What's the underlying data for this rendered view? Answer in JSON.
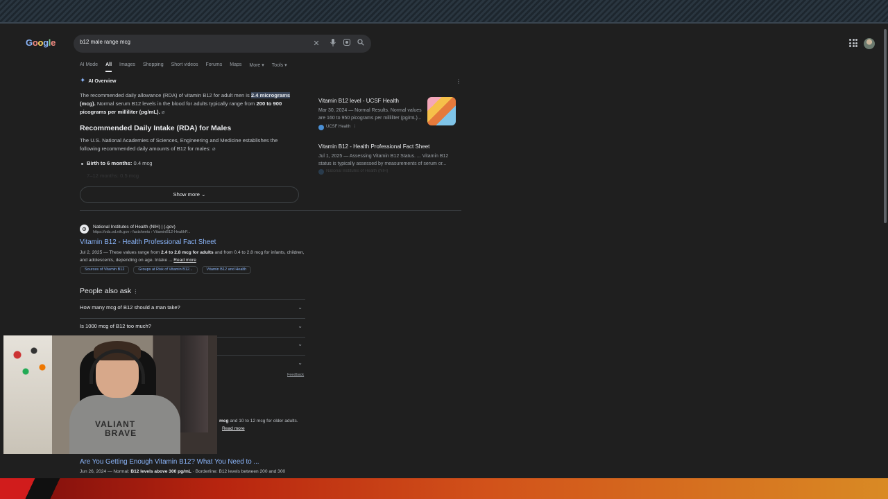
{
  "header": {
    "logo_text": "Google",
    "search_value": "b12 male range mcg",
    "clear_icon": "close-icon",
    "voice_icon": "mic-icon",
    "lens_icon": "lens-icon",
    "search_icon": "search-icon"
  },
  "tabs": [
    "AI Mode",
    "All",
    "Images",
    "Shopping",
    "Short videos",
    "Forums",
    "Maps",
    "More ▾",
    "Tools ▾"
  ],
  "ai_overview": {
    "title": "AI Overview",
    "p1_a": "The recommended daily allowance (RDA) of vitamin B12 for adult men is ",
    "p1_hl": "2.4 micrograms",
    "p1_b": " (mcg).",
    "p1_c": " Normal serum B12 levels in the blood for adults typically range from ",
    "p1_d": "200 to 900 picograms per milliliter (pg/mL).",
    "heading": "Recommended Daily Intake (RDA) for Males",
    "p2": "The U.S. National Academies of Sciences, Engineering and Medicine establishes the following recommended daily amounts of B12 for males:",
    "bullet1_label": "Birth to 6 months:",
    "bullet1_value": " 0.4 mcg",
    "bullet2": "7–12 months: 0.5 mcg",
    "show_more": "Show more ⌄"
  },
  "cards": [
    {
      "title": "Vitamin B12 level - UCSF Health",
      "snippet": "Mar 30, 2024 — Normal Results. Normal values are 160 to 950 picograms per milliliter (pg/mL)...",
      "source": "UCSF Health"
    },
    {
      "title": "Vitamin B12 - Health Professional Fact Sheet",
      "snippet": "Jul 1, 2025 — Assessing Vitamin B12 Status. ... Vitamin B12 status is typically assessed by measurements of serum or...",
      "source": "National Institutes of Health (NIH)"
    }
  ],
  "result1": {
    "site": "National Institutes of Health (NIH) | (.gov)",
    "url": "https://ods.od.nih.gov › factsheets › VitaminB12-HealthP...",
    "title": "Vitamin B12 - Health Professional Fact Sheet",
    "snip_a": "Jul 2, 2025 — These values range from ",
    "snip_b": "2.4 to 2.8 mcg for adults",
    "snip_c": " and from 0.4 to 2.8 mcg for infants, children, and adolescents, depending on age. Intake ... ",
    "read_more": "Read more",
    "chips": [
      "Sources of Vitamin B12",
      "Groups at Risk of Vitamin B12...",
      "Vitamin B12 and Health"
    ]
  },
  "paa": {
    "heading": "People also ask",
    "questions": [
      "How many mcg of B12 should a man take?",
      "Is 1000 mcg of B12 too much?",
      "",
      ""
    ],
    "feedback": "Feedback"
  },
  "result2": {
    "tail_b": "mcg",
    "tail": " and 10 to 12 mcg for older adults.",
    "read_more": "Read more"
  },
  "result3": {
    "title": "Are You Getting Enough Vitamin B12? What You Need to ...",
    "snip_a": "Jun 26, 2024 — Normal: ",
    "snip_b": "B12 levels above 300 pg/mL",
    "snip_c": " · Borderline: B12 levels between 200 and 300"
  },
  "webcam": {
    "shirt_text_1": "VALIANT",
    "shirt_text_2": "BRAVE"
  },
  "colors": {
    "background": "#1f1f1f",
    "link": "#8ab4f8",
    "text": "#bdc1c6",
    "highlight": "#394457"
  }
}
